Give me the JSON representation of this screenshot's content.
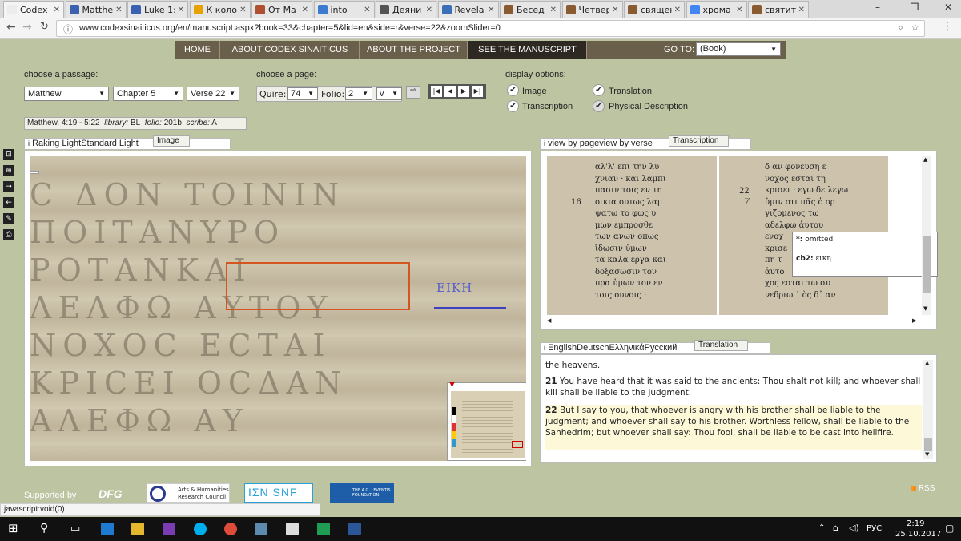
{
  "browser": {
    "tabs": [
      {
        "title": "Codex",
        "color": "#ececec"
      },
      {
        "title": "Matthe",
        "color": "#3a62b0"
      },
      {
        "title": "Luke 1:",
        "color": "#3a62b0"
      },
      {
        "title": "К коло",
        "color": "#e8a200"
      },
      {
        "title": "От Ма",
        "color": "#b05030"
      },
      {
        "title": "into",
        "color": "#3c7bd0"
      },
      {
        "title": "Деяни",
        "color": "#555"
      },
      {
        "title": "Revela",
        "color": "#3b6fb6"
      },
      {
        "title": "Бесед",
        "color": "#8a5a30"
      },
      {
        "title": "Четвер",
        "color": "#8a5a30"
      },
      {
        "title": "священ",
        "color": "#8a5a30"
      },
      {
        "title": "хрома",
        "color": "#4285f4"
      },
      {
        "title": "святит",
        "color": "#8a5a30"
      }
    ],
    "url": "www.codexsinaiticus.org/en/manuscript.aspx?book=33&chapter=5&lid=en&side=r&verse=22&zoomSlider=0",
    "status_text": "javascript:void(0)"
  },
  "nav": {
    "items": [
      "HOME",
      "ABOUT CODEX SINAITICUS",
      "ABOUT THE PROJECT",
      "SEE THE MANUSCRIPT"
    ],
    "goto_label": "GO TO:",
    "goto_value": "(Book)"
  },
  "passage": {
    "label": "choose a passage:",
    "book": "Matthew",
    "chapter": "Chapter 5",
    "verse": "Verse 22"
  },
  "page": {
    "label": "choose a page:",
    "quire_label": "Quire:",
    "quire": "74",
    "folio_label": "Folio:",
    "folio": "2",
    "side": "v"
  },
  "display": {
    "label": "display options:",
    "image": "Image",
    "translation": "Translation",
    "transcription": "Transcription",
    "physical": "Physical Description"
  },
  "info_bar": {
    "range": "Matthew, 4:19 - 5:22",
    "library_label": "library:",
    "library": "BL",
    "folio_label": "folio:",
    "folio": "201b",
    "scribe_label": "scribe:",
    "scribe": "A"
  },
  "image_panel": {
    "tabs": "Raking LightStandard Light",
    "title": "Image",
    "overlay_text": "ΕΙΚΗ"
  },
  "transcription_panel": {
    "tabs": "view by pageview by verse",
    "title": "Transcription",
    "col1_number": "16",
    "col1_lines": [
      "αλ'λ' επι την λυ",
      "χνιαν · και λαμπι",
      "πασιν τοις εν τη",
      "οικια ουτως λαμ",
      "ψατω το φως υ",
      "μων εμπροσθε",
      "των ανων οπως",
      "ἴδωσιν ὑμων",
      "τα καλα εργα και",
      "δοξασωσιν τον",
      "πρα ὑμων τον εν",
      "τοις ουνοις ·"
    ],
    "col2_number": "22",
    "col2_lines": [
      "δ αν φονευση ε",
      "νοχος εσται τη",
      "κρισει · εγω δε λεγω",
      "ὑμιν οτι πᾶς ὁ ορ",
      "γιζομενος τω",
      "αδελφω ἀυτου",
      "ενοχ",
      "κρισε",
      "πη τ",
      "ἀυτο",
      "χος εσται τω συ",
      "νεδριω ˙ ὸς δ᾽ αν"
    ],
    "popup": {
      "star_label": "*:",
      "star_value": "omitted",
      "cb2_label": "cb2:",
      "cb2_value": "εικη"
    }
  },
  "translation_panel": {
    "languages": "EnglishDeutschΕλληνικάРусский",
    "title": "Translation",
    "lead": "the heavens.",
    "v21_num": "21",
    "v21": "You have heard that it was said to the ancients: Thou shalt not kill; and whoever shall kill shall be liable to the judgment.",
    "v22_num": "22",
    "v22": "But I say to you, that whoever is angry with his brother shall be liable to the judgment; and whoever shall say to his brother. Worthless fellow, shall be liable to the Sanhedrim; but whoever shall say: Thou fool, shall be liable to be cast into hellfire."
  },
  "footer": {
    "supported": "Supported by",
    "dfg": "DFG",
    "ahrc": "Arts & Humanities Research Council",
    "snf": "ΙΣΝ SNF",
    "leventis": "THE A.G. LEVENTIS FOUNDATION",
    "rss": "RSS"
  },
  "taskbar": {
    "lang": "РУС",
    "time": "2:19",
    "date": "25.10.2017"
  }
}
